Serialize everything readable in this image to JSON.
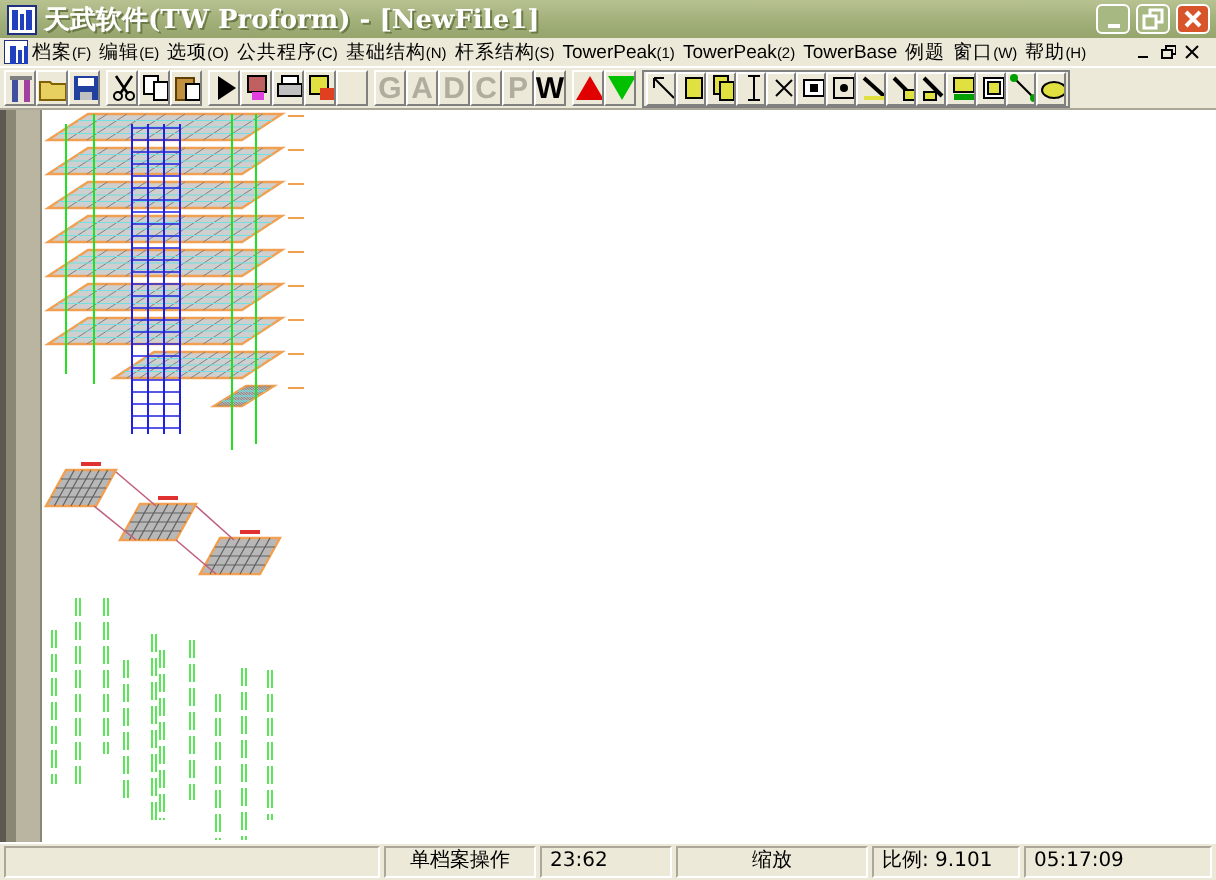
{
  "window": {
    "title": "天武软件(TW Proform) - [NewFile1]"
  },
  "menu": [
    {
      "label": "档案",
      "key": "(F)"
    },
    {
      "label": "编辑",
      "key": "(E)"
    },
    {
      "label": "选项",
      "key": "(O)"
    },
    {
      "label": "公共程序",
      "key": "(C)"
    },
    {
      "label": "基础结构",
      "key": "(N)"
    },
    {
      "label": "杆系结构",
      "key": "(S)"
    },
    {
      "label": "TowerPeak",
      "key": "(1)"
    },
    {
      "label": "TowerPeak",
      "key": "(2)"
    },
    {
      "label": "TowerBase"
    },
    {
      "label": "例题"
    },
    {
      "label": "窗口",
      "key": "(W)"
    },
    {
      "label": "帮助",
      "key": "(H)"
    }
  ],
  "toolbar_letters": [
    {
      "label": "G",
      "disabled": true
    },
    {
      "label": "A",
      "disabled": true
    },
    {
      "label": "D",
      "disabled": true
    },
    {
      "label": "C",
      "disabled": true
    },
    {
      "label": "P",
      "disabled": true
    },
    {
      "label": "W",
      "disabled": false
    }
  ],
  "status_bar": [
    "单档案操作",
    "23:62",
    "缩放",
    "比例:  9.101",
    "05:17:09"
  ]
}
